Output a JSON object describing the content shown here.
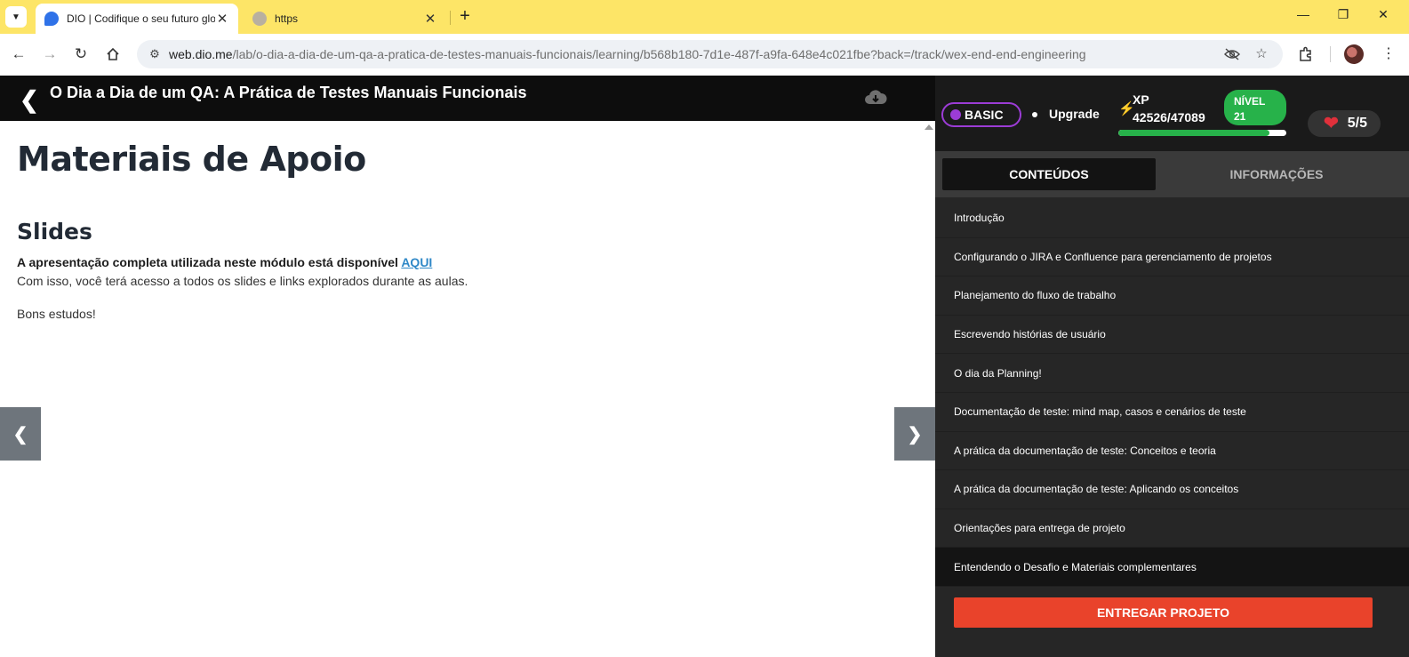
{
  "browser": {
    "tabs": [
      {
        "title": "DIO | Codifique o seu futuro glo",
        "active": true
      },
      {
        "title": "https",
        "active": false
      }
    ],
    "url_host": "web.dio.me",
    "url_path": "/lab/o-dia-a-dia-de-um-qa-a-pratica-de-testes-manuais-funcionais/learning/b568b180-7d1e-487f-a9fa-648e4c021fbe?back=/track/wex-end-end-engineering",
    "icons": {
      "back": "arrow-left-icon",
      "forward": "arrow-right-icon",
      "reload": "reload-icon",
      "home": "home-icon",
      "extensions": "puzzle-icon",
      "menu": "kebab-menu-icon"
    }
  },
  "header": {
    "title": "O Dia a Dia de um QA: A Prática de Testes Manuais Funcionais"
  },
  "content": {
    "heading": "Materiais de Apoio",
    "subheading": "Slides",
    "intro_text": "A apresentação completa utilizada neste módulo está disponível ",
    "link_text": "AQUI",
    "body_text": "Com isso, você terá acesso a todos os slides e links explorados durante as aulas.",
    "closing_text": "Bons estudos!"
  },
  "user": {
    "plan": "BASIC",
    "upgrade_label": "Upgrade",
    "xp_label": "XP",
    "xp_value": "42526/47089",
    "xp_progress": 0.9,
    "level_label": "NÍVEL",
    "level_value": "21",
    "lives": "5/5"
  },
  "sidebar": {
    "tabs": [
      {
        "label": "CONTEÚDOS",
        "active": true
      },
      {
        "label": "INFORMAÇÕES",
        "active": false
      }
    ],
    "lessons": [
      {
        "label": "Introdução"
      },
      {
        "label": "Configurando o JIRA e Confluence para gerenciamento de projetos"
      },
      {
        "label": "Planejamento do fluxo de trabalho"
      },
      {
        "label": "Escrevendo histórias de usuário"
      },
      {
        "label": "O dia da Planning!"
      },
      {
        "label": "Documentação de teste: mind map, casos e cenários de teste"
      },
      {
        "label": "A prática da documentação de teste: Conceitos e teoria"
      },
      {
        "label": "A prática da documentação de teste: Aplicando os conceitos"
      },
      {
        "label": "Orientações para entrega de projeto"
      },
      {
        "label": "Entendendo o Desafio e Materiais complementares",
        "current": true
      }
    ],
    "submit_label": "ENTREGAR PROJETO"
  },
  "colors": {
    "tabstrip": "#fde567",
    "accent_red": "#e9432b",
    "level_green": "#27b24a",
    "plan_purple": "#9c3cd6",
    "link_blue": "#2f88c7"
  }
}
